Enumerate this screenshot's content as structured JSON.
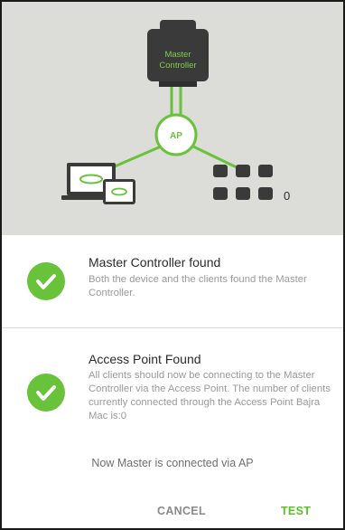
{
  "diagram": {
    "controller_label_line1": "Master",
    "controller_label_line2": "Controller",
    "ap_label": "AP",
    "client_count": "0"
  },
  "items": [
    {
      "title": "Master Controller found",
      "description": "Both the device and the clients found the Master Controller."
    },
    {
      "title": "Access Point Found",
      "description": "All clients should now be connecting to the Master Controller via the Access Point. The number of clients currently connected through the Access Point Bajra Mac is:0"
    }
  ],
  "status_text": "Now Master is connected via AP",
  "buttons": {
    "cancel": "CANCEL",
    "test": "TEST"
  },
  "colors": {
    "accent_green": "#68c23a",
    "hero_background": "#dcdcd8",
    "device_dark": "#3a3a3a"
  }
}
